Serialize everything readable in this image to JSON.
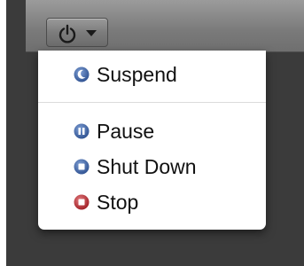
{
  "menu": {
    "items": [
      {
        "label": "Suspend",
        "icon": "moon-icon",
        "color": "#3b5f9e"
      },
      {
        "label": "Pause",
        "icon": "pause-icon",
        "color": "#3b5f9e"
      },
      {
        "label": "Shut Down",
        "icon": "shutdown-icon",
        "color": "#3b5f9e"
      },
      {
        "label": "Stop",
        "icon": "stop-icon",
        "color": "#c0272d"
      }
    ]
  },
  "toolbar": {
    "power_icon": "power-icon",
    "dropdown_icon": "chevron-down-icon"
  }
}
